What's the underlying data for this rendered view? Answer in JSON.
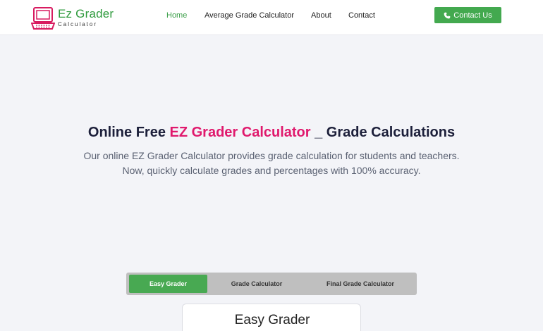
{
  "brand": {
    "title": "Ez Grader",
    "subtitle": "Calculator",
    "logo_icon": "laptop-icon",
    "colors": {
      "primary_green": "#43a94f",
      "brand_pink": "#d81b60"
    }
  },
  "nav": {
    "items": [
      {
        "label": "Home",
        "active": true
      },
      {
        "label": "Average Grade Calculator",
        "active": false
      },
      {
        "label": "About",
        "active": false
      },
      {
        "label": "Contact",
        "active": false
      }
    ],
    "contact_button": {
      "label": "Contact Us",
      "icon": "phone-icon"
    }
  },
  "hero": {
    "title_prefix": "Online Free ",
    "title_highlight": "EZ Grader Calculator",
    "title_suffix": " _ Grade Calculations",
    "description": "Our online EZ Grader Calculator provides grade calculation for students and teachers. Now, quickly calculate grades and percentages with 100% accuracy."
  },
  "tabs": {
    "items": [
      {
        "label": "Easy Grader",
        "active": true
      },
      {
        "label": "Grade Calculator",
        "active": false
      },
      {
        "label": "Final Grade Calculator",
        "active": false
      }
    ]
  },
  "card": {
    "title": "Easy Grader"
  }
}
